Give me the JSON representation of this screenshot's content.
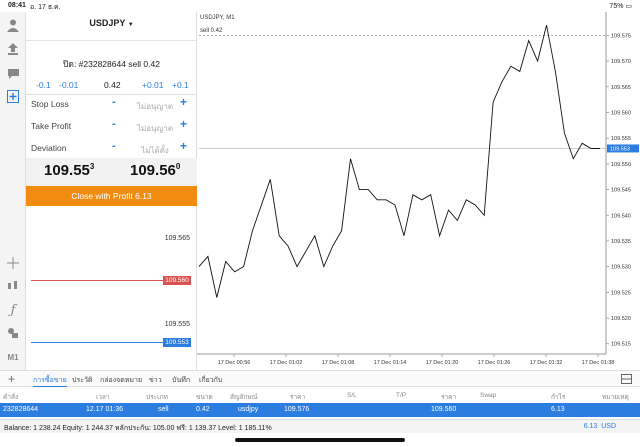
{
  "status_bar": {
    "time": "08:41",
    "date": "อ. 17 ธ.ค.",
    "right": "75% ▭"
  },
  "left_toolbar": {
    "icons": [
      "person-icon",
      "share-icon",
      "chat-icon",
      "new-order-icon"
    ],
    "lower_icons": [
      "crosshair-icon",
      "indicators-icon",
      "function-icon",
      "objects-icon"
    ],
    "timeframe": "M1"
  },
  "order_panel": {
    "symbol": "USDJPY",
    "symbol_arrow": "▼",
    "order_info": "ปิด: #232828644 sell 0.42",
    "volume_adjust": {
      "minus_big": "-0.1",
      "minus_small": "-0.01",
      "value": "0.42",
      "plus_small": "+0.01",
      "plus_big": "+0.1"
    },
    "fields": [
      {
        "label": "Stop Loss",
        "value": "ไม่อนุญาต"
      },
      {
        "label": "Take Profit",
        "value": "ไม่อนุญาต"
      },
      {
        "label": "Deviation",
        "value": "ไม่ได้ตั้ง"
      }
    ],
    "minus_sign": "-",
    "plus_sign": "+",
    "bid": {
      "main": "109.55",
      "sup": "3"
    },
    "ask": {
      "main": "109.56",
      "sup": "0"
    },
    "close_button": "Close with Profit 6.13",
    "price_labels": {
      "p565": "109.565",
      "p555": "109.555"
    },
    "tags": {
      "open": "109.560",
      "current": "109.553"
    },
    "colors": {
      "close_button": "#f28c10",
      "open_tag": "#d9534f",
      "current_tag": "#2b7de0"
    }
  },
  "chart": {
    "title": "USDJPY, M1",
    "sell_label": "sell 0.42",
    "y_ticks": [
      "109.575",
      "109.570",
      "109.565",
      "109.560",
      "109.555",
      "109.550",
      "109.545",
      "109.540",
      "109.535",
      "109.530",
      "109.525",
      "109.520",
      "109.515"
    ],
    "y_price_tags": {
      "current": "109.553"
    },
    "x_ticks": [
      "17 Dec 00:56",
      "17 Dec 01:02",
      "17 Dec 01:08",
      "17 Dec 01:14",
      "17 Dec 01:20",
      "17 Dec 01:26",
      "17 Dec 01:32",
      "17 Dec 01:38"
    ]
  },
  "chart_data": {
    "type": "line",
    "title": "USDJPY, M1",
    "ylim": [
      109.513,
      109.578
    ],
    "values": [
      109.53,
      109.532,
      109.524,
      109.531,
      109.529,
      109.53,
      109.537,
      109.542,
      109.547,
      109.536,
      109.534,
      109.53,
      109.533,
      109.536,
      109.53,
      109.534,
      109.537,
      109.551,
      109.545,
      109.545,
      109.543,
      109.543,
      109.542,
      109.536,
      109.544,
      109.543,
      109.544,
      109.536,
      109.541,
      109.539,
      109.543,
      109.542,
      109.54,
      109.562,
      109.566,
      109.569,
      109.568,
      109.574,
      109.57,
      109.577,
      109.568,
      109.556,
      109.551,
      109.554,
      109.553,
      109.553
    ],
    "sell_line": 109.575,
    "current_price": 109.553,
    "grid": false
  },
  "bottom_tabs": {
    "plus": "+",
    "items": [
      "การซื้อขาย",
      "ประวัติ",
      "กล่องจดหมาย",
      "ข่าว",
      "บันทึก",
      "เกี่ยวกับ"
    ],
    "right_icon": "layout-icon"
  },
  "table": {
    "headers": [
      "คำสั่ง",
      "เวลา",
      "ประเภท",
      "ขนาด",
      "สัญลักษณ์",
      "ราคา",
      "S/L",
      "T/P",
      "ราคา",
      "Swap",
      "กำไร",
      "หมายเหตุ"
    ],
    "row": [
      "232828644",
      "12.17 01:36",
      "sell",
      "0.42",
      "usdjpy",
      "109.576",
      "",
      "",
      "109.560",
      "",
      "6.13",
      ""
    ]
  },
  "footer": {
    "summary": "Balance: 1 238.24 Equity: 1 244.37 หลักประกัน: 105.00 ฟรี: 1 139.37 Level: 1 185.11%",
    "total": "6.13",
    "currency": "USD"
  }
}
